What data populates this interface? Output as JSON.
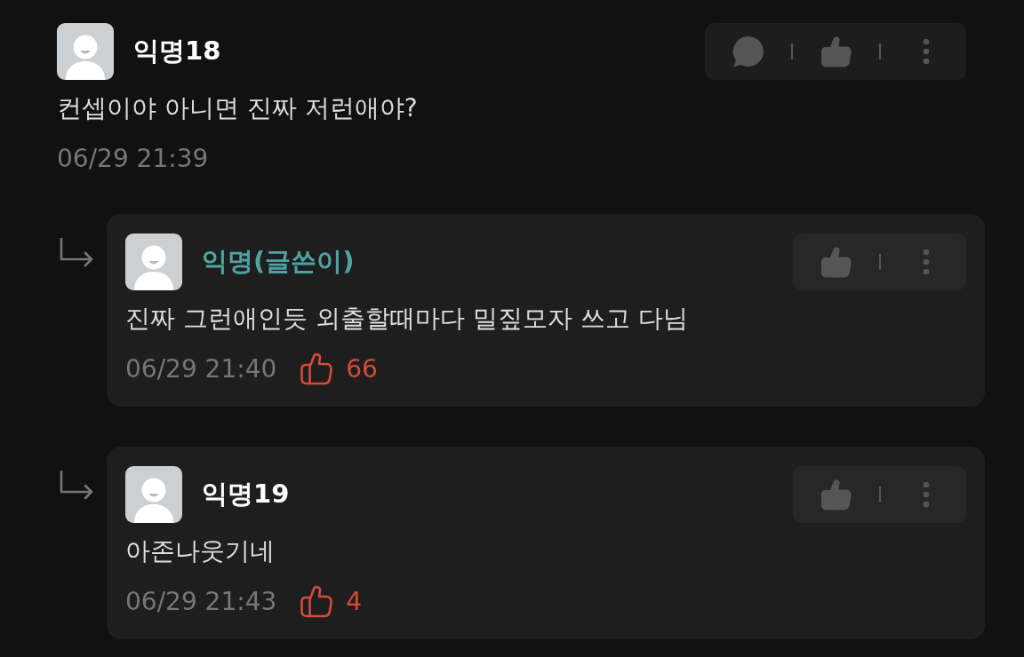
{
  "comment": {
    "author": "익명18",
    "is_writer": false,
    "body": "컨셉이야 아니면 진짜 저런애야?",
    "time": "06/29 21:39",
    "actions": [
      {
        "kind": "reply"
      },
      {
        "kind": "like"
      },
      {
        "kind": "more"
      }
    ]
  },
  "replies": [
    {
      "author": "익명(글쓴이)",
      "is_writer": true,
      "body": "진짜 그런애인듯 외출할때마다 밀짚모자 쓰고 다님",
      "time": "06/29 21:40",
      "likes": "66",
      "actions": [
        {
          "kind": "like"
        },
        {
          "kind": "more"
        }
      ]
    },
    {
      "author": "익명19",
      "is_writer": false,
      "body": "아존나웃기네",
      "time": "06/29 21:43",
      "likes": "4",
      "actions": [
        {
          "kind": "like"
        },
        {
          "kind": "more"
        }
      ]
    }
  ]
}
